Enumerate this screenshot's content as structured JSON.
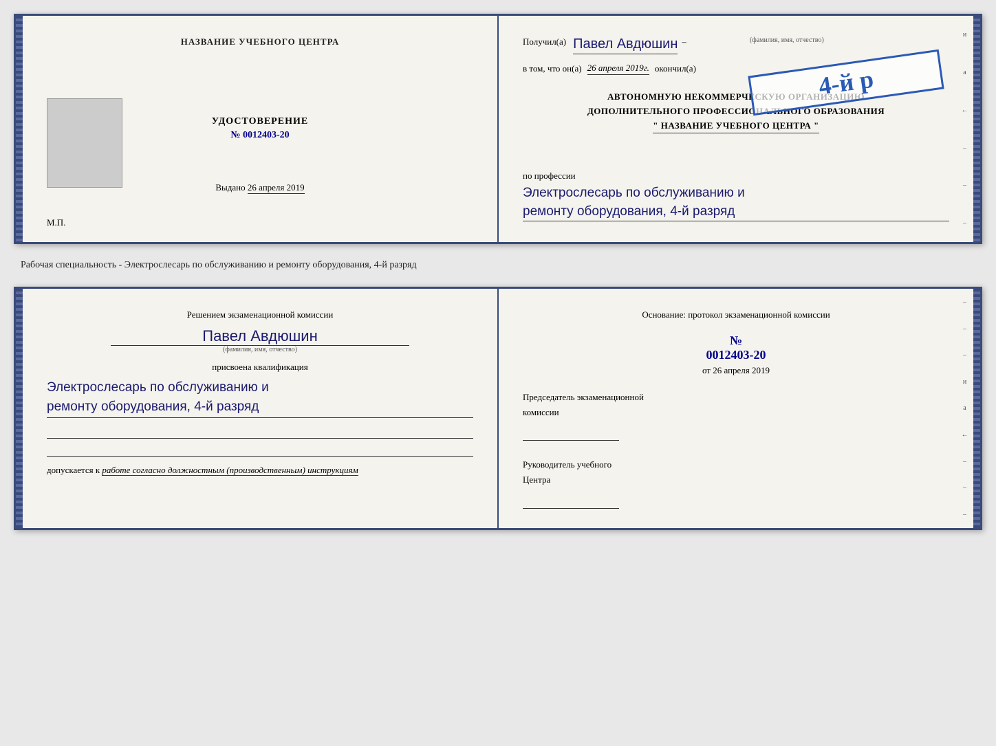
{
  "topDoc": {
    "left": {
      "centerTitle": "НАЗВАНИЕ УЧЕБНОГО ЦЕНТРА",
      "photoAlt": "photo",
      "udostLabel": "УДОСТОВЕРЕНИЕ",
      "numberPrefix": "№",
      "number": "0012403-20",
      "issuedLabel": "Выдано",
      "issuedDate": "26 апреля 2019",
      "mpLabel": "М.П."
    },
    "right": {
      "receivedLabel": "Получил(а)",
      "receivedName": "Павел Авдюшин",
      "fioHint": "(фамилия, имя, отчество)",
      "dash1": "–",
      "vtomLabel": "в том, что он(а)",
      "vtomDate": "26 апреля 2019г.",
      "okonchilLabel": "окончил(а)",
      "stampGrade": "4-й р",
      "orgLine1": "АВТОНОМНУЮ НЕКОММЕРЧЕСКУЮ ОРГАНИЗАЦИЮ",
      "orgLine2": "ДОПОЛНИТЕЛЬНОГО ПРОФЕССИОНАЛЬНОГО ОБРАЗОВАНИЯ",
      "orgName": "\" НАЗВАНИЕ УЧЕБНОГО ЦЕНТРА \"",
      "profLabel": "по профессии",
      "profValue1": "Электрослесарь по обслуживанию и",
      "profValue2": "ремонту оборудования, 4-й разряд",
      "sideMarks": [
        "и",
        "а",
        "←",
        "–",
        "–",
        "–"
      ]
    }
  },
  "middleText": "Рабочая специальность - Электрослесарь по обслуживанию и ремонту оборудования, 4-й разряд",
  "bottomDoc": {
    "left": {
      "decisionTitle1": "Решением экзаменационной  комиссии",
      "personName": "Павел Авдюшин",
      "fioHint": "(фамилия, имя, отчество)",
      "assignedLabel": "присвоена квалификация",
      "qualValue1": "Электрослесарь по обслуживанию и",
      "qualValue2": "ремонту оборудования, 4-й разряд",
      "dopuskaetsyaLabel": "допускается к",
      "dopuskaetsyaValue": "работе согласно должностным (производственным) инструкциям"
    },
    "right": {
      "osnovTitle1": "Основание: протокол экзаменационной  комиссии",
      "numberPrefix": "№",
      "number": "0012403-20",
      "datePrefix": "от",
      "date": "26 апреля 2019",
      "predsedatelLabel1": "Председатель экзаменационной",
      "predsedatelLabel2": "комиссии",
      "rukovoditelLabel1": "Руководитель учебного",
      "rukovoditelLabel2": "Центра",
      "sideMarks": [
        "–",
        "–",
        "–",
        "и",
        "а",
        "←",
        "–",
        "–",
        "–"
      ]
    }
  }
}
